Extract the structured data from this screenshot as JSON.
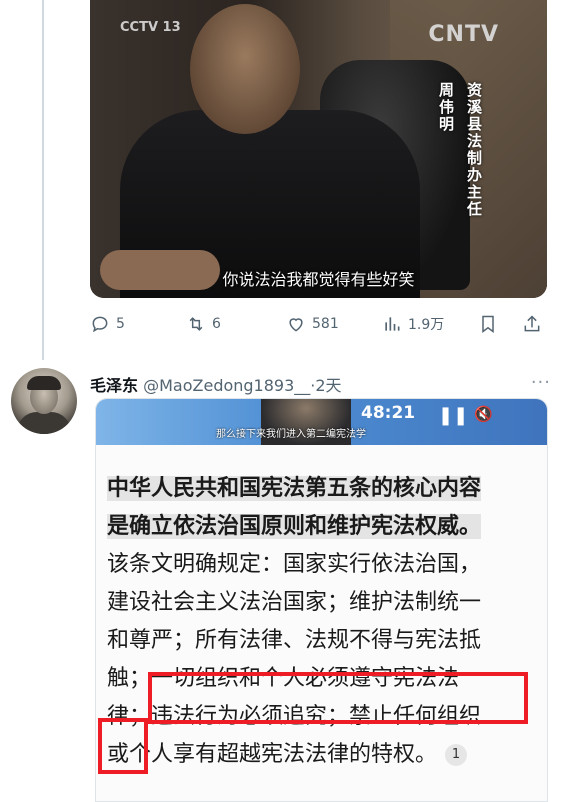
{
  "video": {
    "logo_left": "CCTV 13",
    "logo_right": "CNTV",
    "caption_name": "周伟明",
    "caption_title": "资溪县法制办主任",
    "subtitle": "你说法治我都觉得有些好笑"
  },
  "actions": {
    "replies": "5",
    "retweets": "6",
    "likes": "581",
    "views": "1.9万"
  },
  "reply": {
    "author_name": "毛泽东",
    "handle_time": "@MaoZedong1893__·2天",
    "more": "···"
  },
  "embedded_video": {
    "time": "48:21",
    "subtitle": "那么接下来我们进入第二编宪法学"
  },
  "article": {
    "line1": "中华人民共和国宪法第五条的核心内容",
    "line2": "是确立依法治国原则和维护宪法权威。",
    "line3": "该条文明确规定：国家实行依法治国，",
    "line4": "建设社会主义法治国家；维护法制统一",
    "line5": "和尊严；所有法律、法规不得与宪法抵",
    "line6_a": "触；",
    "line6_b": "一切组织和个人必须遵守宪法法",
    "line7_a": "律",
    "line7_b": "；违法行为必须追究；禁止任何组织",
    "line8": "或个人享有超越宪法法律的特权。",
    "footnote": "1"
  },
  "colors": {
    "highlight_box": "#ee1c25",
    "muted": "#536471"
  }
}
